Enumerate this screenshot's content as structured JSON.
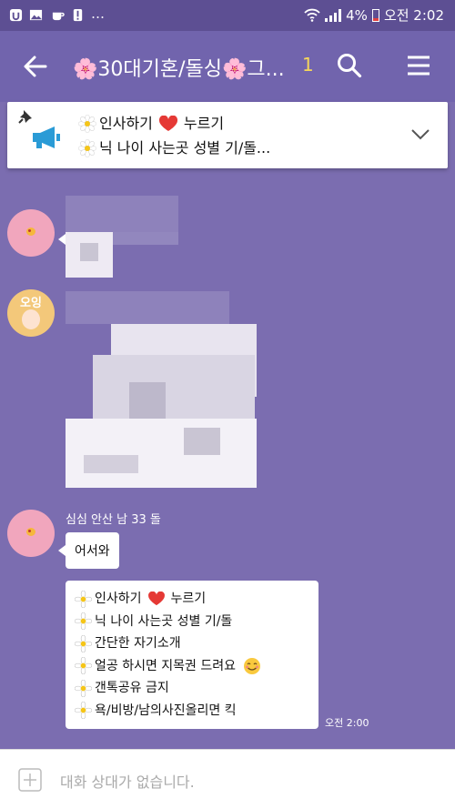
{
  "status_bar": {
    "battery": "4%",
    "time": "오전 2:02",
    "notification_icons": [
      "sync-icon",
      "image-icon",
      "coffee-icon",
      "alert-icon",
      "more-icon"
    ]
  },
  "header": {
    "title": "🌸30대기혼/돌싱🌸그...",
    "member_count": "1",
    "back_icon": "arrow-left-icon",
    "search_icon": "search-icon",
    "menu_icon": "hamburger-menu-icon"
  },
  "notice": {
    "line1_prefix": "인사하기",
    "line1_suffix": "누르기",
    "line2": "닉 나이 사는곳 성별  기/돌..."
  },
  "messages": [
    {
      "type": "image"
    },
    {
      "type": "image"
    },
    {
      "sender": "심심 안산 남 33 돌",
      "text": "어서와"
    },
    {
      "lines": [
        "인사하기",
        "누르기",
        "닉 나이 사는곳 성별  기/돌",
        "간단한 자기소개",
        "얼공 하시면 지목권 드려요",
        "갠톡공유 금지",
        "욕/비방/남의사진올리면 킥"
      ],
      "time": "오전 2:00"
    }
  ],
  "avatar_label": "오잉",
  "input": {
    "placeholder": "대화 상대가 없습니다."
  },
  "colors": {
    "background": "#7b6db0",
    "header": "#7164ad",
    "status_bar": "#5d4f93",
    "bubble": "#ffffff",
    "accent_count": "#f6d65a"
  }
}
